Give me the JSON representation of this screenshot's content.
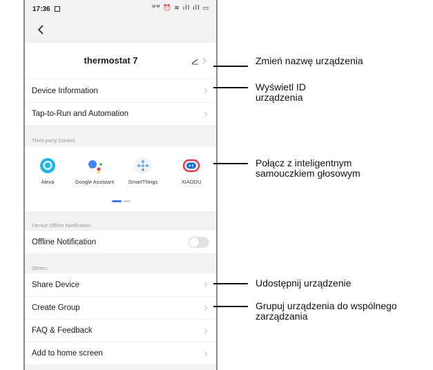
{
  "status_bar": {
    "time": "17:36",
    "indicators": "ᵂᴹ ⏰ ≋ ıll ıll ▭"
  },
  "header": {
    "back_icon": "chevron-left-icon",
    "device_name": "thermostat 7",
    "edit_icon": "pencil-icon"
  },
  "menu_top": [
    {
      "label": "Device Information"
    },
    {
      "label": "Tap-to-Run and Automation"
    }
  ],
  "third_party": {
    "section_label": "Third-party Control",
    "items": [
      {
        "label": "Alexa",
        "icon": "alexa-icon",
        "color": "#1fb6ea"
      },
      {
        "label": "Google Assistant",
        "icon": "google-assistant-icon",
        "color": "#4285f4"
      },
      {
        "label": "SmartThings",
        "icon": "smartthings-icon",
        "color": "#5a9ed6"
      },
      {
        "label": "XIAODU",
        "icon": "xiaodu-icon",
        "color": "#e8344a"
      }
    ]
  },
  "offline": {
    "section_label": "Device Offline Notification",
    "row_label": "Offline Notification",
    "toggle_on": false
  },
  "others": {
    "section_label": "Others",
    "items": [
      {
        "label": "Share Device"
      },
      {
        "label": "Create Group"
      },
      {
        "label": "FAQ & Feedback"
      },
      {
        "label": "Add to home screen"
      }
    ]
  },
  "annotations": [
    {
      "text": "Zmień nazwę urządzenia"
    },
    {
      "text": "Wyświetl ID urządzenia"
    },
    {
      "text": "Połącz z inteligentnym samouczkiem głosowym"
    },
    {
      "text": "Udostępnij urządzenie"
    },
    {
      "text": "Grupuj urządzenia do wspólnego zarządzania"
    }
  ]
}
